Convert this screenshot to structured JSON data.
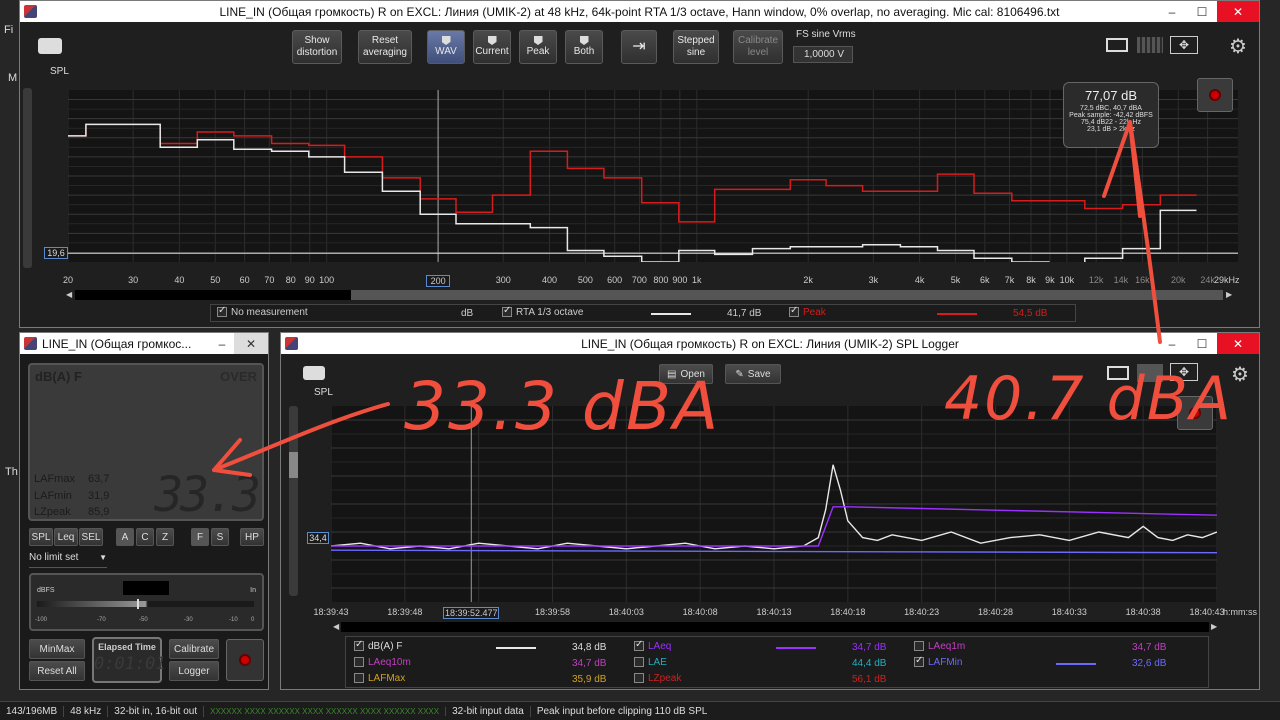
{
  "taskbar_left": [
    "Fi",
    "M",
    "Th"
  ],
  "rta": {
    "title": "LINE_IN (Общая громкость) R on EXCL: Линия (UMIK-2) at 48 kHz, 64k-point RTA 1/3 octave, Hann window, 0% overlap, no averaging. Mic cal: 8106496.txt",
    "buttons": {
      "show_distortion": "Show\ndistortion",
      "reset_averaging": "Reset\naveraging",
      "wav": "WAV",
      "current": "Current",
      "peak": "Peak",
      "both": "Both",
      "stepped_sine": "Stepped\nsine",
      "calibrate_level": "Calibrate\nlevel"
    },
    "fs_label": "FS sine Vrms",
    "fs_value": "1,0000 V",
    "spl_label": "SPL",
    "y_ticks": [
      "100",
      "90",
      "80",
      "70",
      "60",
      "50",
      "40",
      "30"
    ],
    "cursor_value": "19,6",
    "x_ticks": [
      "20",
      "30",
      "40",
      "50",
      "60",
      "70",
      "80",
      "90",
      "100",
      "200",
      "300",
      "400",
      "500",
      "600",
      "700",
      "800",
      "900",
      "1k",
      "2k",
      "3k",
      "4k",
      "5k",
      "6k",
      "7k",
      "8k",
      "9k",
      "10k",
      "12k",
      "14k",
      "16k",
      "20k",
      "24k"
    ],
    "x_unit": "29kHz",
    "x_cursor": "200",
    "readout": {
      "big": "77,07 dB",
      "line1": "72,5 dBC, 40,7 dBA",
      "line2": "Peak sample: -42,42 dBFS",
      "line3": "75,4 dB22 - 22k Hz",
      "line4": "23,1 dB > 2kHz"
    },
    "legend": {
      "no_measurement": "No measurement",
      "unit": "dB",
      "rta_name": "RTA 1/3 octave",
      "rta_value": "41,7 dB",
      "peak_name": "Peak",
      "peak_value": "54,5 dB"
    },
    "colors": {
      "current": "#e8e8e8",
      "peak": "#d81b1b"
    },
    "chart_data": {
      "type": "line",
      "x_scale": "log",
      "ylabel": "SPL",
      "ylim": [
        15,
        105
      ],
      "xlim": [
        20,
        29000
      ],
      "series": [
        {
          "name": "RTA 1/3 octave",
          "x": [
            20,
            25,
            31.5,
            40,
            50,
            63,
            80,
            100,
            125,
            160,
            200,
            250,
            315,
            400,
            500,
            630,
            800,
            1000,
            1250,
            1600,
            2000,
            2500,
            3150,
            4000,
            5000,
            6300,
            8000,
            10000,
            12500,
            16000,
            20000
          ],
          "y": [
            81,
            87,
            87,
            75,
            79,
            74,
            73,
            70,
            62,
            52,
            40,
            35,
            35,
            33,
            21,
            18,
            15,
            21,
            19,
            22,
            23,
            23,
            24,
            23,
            21,
            17,
            15,
            14,
            17,
            22,
            42
          ]
        },
        {
          "name": "Peak",
          "x": [
            20,
            25,
            31.5,
            40,
            50,
            63,
            80,
            100,
            125,
            160,
            200,
            250,
            315,
            400,
            500,
            630,
            800,
            1000,
            1250,
            1600,
            2000,
            2500,
            3150,
            4000,
            5000,
            6300,
            8000,
            10000,
            12500,
            16000,
            20000
          ],
          "y": [
            81,
            87,
            87,
            77,
            83,
            81,
            77,
            76,
            70,
            59,
            48,
            41,
            50,
            73,
            64,
            59,
            46,
            36,
            53,
            53,
            58,
            55,
            52,
            52,
            61,
            51,
            47,
            47,
            43,
            45,
            50
          ]
        }
      ]
    }
  },
  "meter": {
    "title": "LINE_IN (Общая громкос...",
    "mode": "dB(A) F",
    "over": "OVER",
    "value": "33.3",
    "stats": [
      {
        "label": "LAFmax",
        "value": "63,7"
      },
      {
        "label": "LAFmin",
        "value": "31,9"
      },
      {
        "label": "LZpeak",
        "value": "85,9"
      }
    ],
    "mode_buttons": [
      "SPL",
      "Leq",
      "SEL"
    ],
    "weight_buttons": [
      "A",
      "C",
      "Z"
    ],
    "speed_buttons": [
      "F",
      "S"
    ],
    "hp": "HP",
    "limit": "No limit set",
    "dbfs_label": "dBFS",
    "dbfs_in": "In",
    "dbfs_ticks": [
      "-100",
      "-70",
      "-50",
      "-30",
      "-10",
      "0"
    ],
    "minmax": "MinMax",
    "reset_all": "Reset All",
    "elapsed_label": "Elapsed Time",
    "elapsed_value": "0:01:01",
    "calibrate": "Calibrate",
    "logger": "Logger"
  },
  "logger": {
    "title": "LINE_IN (Общая громкость) R on EXCL: Линия (UMIK-2) SPL Logger",
    "open": "Open",
    "save": "Save",
    "spl_label": "SPL",
    "y_ticks": [
      "80",
      "70",
      "60",
      "50",
      "40",
      "30",
      "20"
    ],
    "cursor_value": "34,4",
    "x_ticks": [
      "18:39:43",
      "18:39:48",
      "18:39:52.477",
      "18:39:58",
      "18:40:03",
      "18:40:08",
      "18:40:13",
      "18:40:18",
      "18:40:23",
      "18:40:28",
      "18:40:33",
      "18:40:38",
      "18:40:43"
    ],
    "x_unit": "h:mm:ss",
    "legend": [
      {
        "name": "dB(A) F",
        "value": "34,8 dB",
        "checked": true,
        "color": "#e8e8e8"
      },
      {
        "name": "LAeq",
        "value": "34,7 dB",
        "checked": true,
        "color": "#9b30ff"
      },
      {
        "name": "LAeq1m",
        "value": "34,7 dB",
        "checked": false,
        "color": "#c040c0"
      },
      {
        "name": "LAeq10m",
        "value": "34,7 dB",
        "checked": false,
        "color": "#c040c0"
      },
      {
        "name": "LAE",
        "value": "44,4 dB",
        "checked": false,
        "color": "#20b0c0"
      },
      {
        "name": "LAFMin",
        "value": "32,6 dB",
        "checked": true,
        "color": "#6a6aff"
      },
      {
        "name": "LAFMax",
        "value": "35,9 dB",
        "checked": false,
        "color": "#d0a020"
      },
      {
        "name": "LZpeak",
        "value": "56,1 dB",
        "checked": false,
        "color": "#d02020"
      }
    ],
    "chart_data": {
      "type": "line",
      "ylabel": "SPL",
      "ylim": [
        15,
        85
      ],
      "xlim": [
        0,
        60
      ],
      "series": [
        {
          "name": "dB(A) F",
          "x": [
            0,
            2,
            4,
            6,
            8,
            10,
            12,
            14,
            16,
            18,
            20,
            22,
            24,
            26,
            28,
            30,
            32,
            33,
            33.5,
            34,
            34.5,
            35,
            36,
            37,
            38,
            40,
            42,
            44,
            46,
            48,
            50,
            52,
            54,
            55,
            56,
            57,
            58,
            59,
            60
          ],
          "y": [
            35,
            36,
            34,
            35,
            34,
            36,
            35,
            34,
            36,
            35,
            34,
            35,
            36,
            34,
            35,
            34,
            35,
            38,
            48,
            64,
            55,
            44,
            38,
            37,
            39,
            37,
            40,
            36,
            38,
            39,
            37,
            40,
            38,
            42,
            38,
            37,
            39,
            38,
            40
          ]
        },
        {
          "name": "LAeq",
          "x": [
            0,
            33,
            34,
            35,
            60
          ],
          "y": [
            35,
            35,
            49,
            49,
            46
          ]
        },
        {
          "name": "LAFMin",
          "x": [
            0,
            60
          ],
          "y": [
            33.5,
            32.6
          ]
        }
      ]
    }
  },
  "status": {
    "mem": "143/196MB",
    "rate": "48 kHz",
    "bits": "32-bit in, 16-bit out",
    "xo": "XXXXXX XXXX  XXXXXX XXXX  XXXXXX XXXX  XXXXXX XXXX",
    "input": "32-bit input data",
    "clip": "Peak input before clipping 110 dB SPL"
  },
  "annotations": {
    "left": "33.3 dBA",
    "right": "40.7 dBA"
  }
}
